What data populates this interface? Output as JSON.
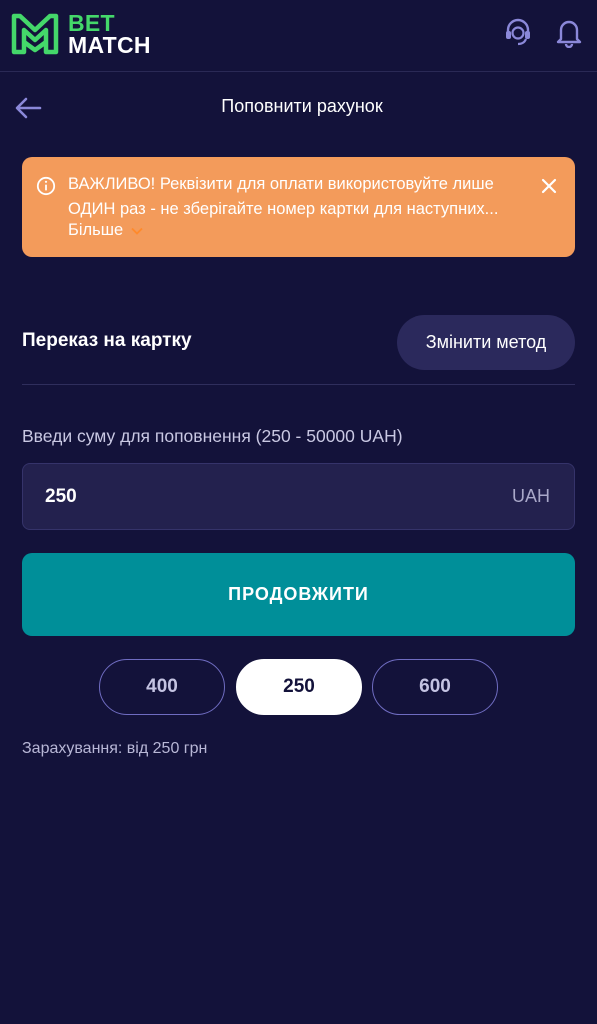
{
  "header": {
    "brand_line1": "BET",
    "brand_line2": "MATCH",
    "icons": [
      "support-headset-icon",
      "bell-icon"
    ]
  },
  "nav": {
    "title": "Поповнити рахунок",
    "back_icon": "arrow-left-icon"
  },
  "alert": {
    "text": "ВАЖЛИВО! Реквізити для оплати використовуйте лише ОДИН раз - не зберігайте номер картки для наступних...",
    "more_label": "Більше",
    "icon": "info-circle-icon",
    "color": "#f39b5b"
  },
  "method": {
    "label": "Переказ на картку",
    "change_label": "Змінити метод"
  },
  "amount": {
    "label": "Введи суму для поповнення (250 - 50000 UAH)",
    "value": "250",
    "currency": "UAH"
  },
  "continue_label": "ПРОДОВЖИТИ",
  "presets": [
    {
      "label": "400",
      "active": false
    },
    {
      "label": "250",
      "active": true
    },
    {
      "label": "600",
      "active": false
    }
  ],
  "credit_note": "Зарахування: від 250 грн",
  "colors": {
    "background": "#13123a",
    "accent": "#008f99",
    "brand_green": "#44d76a",
    "warning": "#f39b5b"
  }
}
